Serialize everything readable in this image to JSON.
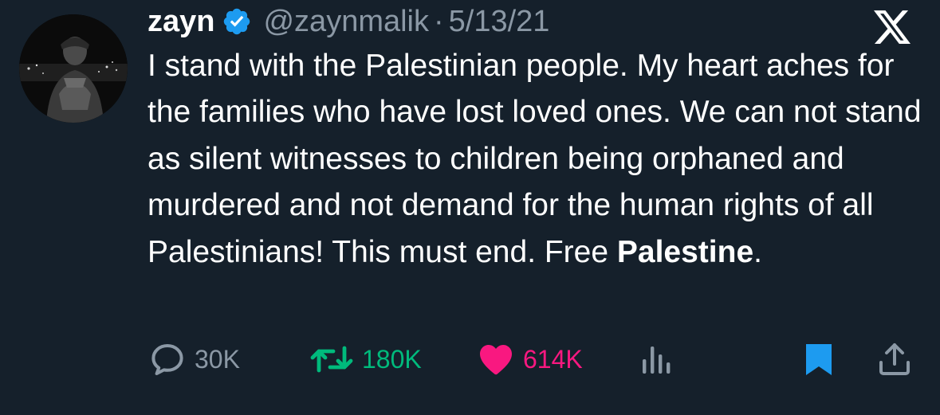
{
  "tweet": {
    "author": {
      "display_name": "zayn",
      "handle": "@zaynmalik",
      "verified": true
    },
    "separator": "·",
    "date": "5/13/21",
    "platform_logo": "x-logo",
    "text_main": "I stand with the Palestinian people. My heart aches for the families who have lost loved ones. We can not stand as silent witnesses to children being orphaned and murdered and not demand for the human rights of all Palestinians!  This must end. Free ",
    "text_emphasis": "Palestine",
    "text_end": ".",
    "actions": {
      "reply": {
        "icon": "reply-icon",
        "count": "30K"
      },
      "retweet": {
        "icon": "retweet-icon",
        "count": "180K"
      },
      "like": {
        "icon": "heart-icon",
        "count": "614K",
        "active": true
      },
      "views": {
        "icon": "views-icon"
      },
      "bookmark": {
        "icon": "bookmark-icon",
        "active": true
      },
      "share": {
        "icon": "share-icon"
      }
    }
  },
  "colors": {
    "background": "#15202b",
    "text": "#ffffff",
    "secondary_text": "#8b98a5",
    "verified_blue": "#1d9bf0",
    "retweet_green": "#00ba7c",
    "like_pink": "#f91880",
    "bookmark_blue": "#1d9bf0"
  }
}
